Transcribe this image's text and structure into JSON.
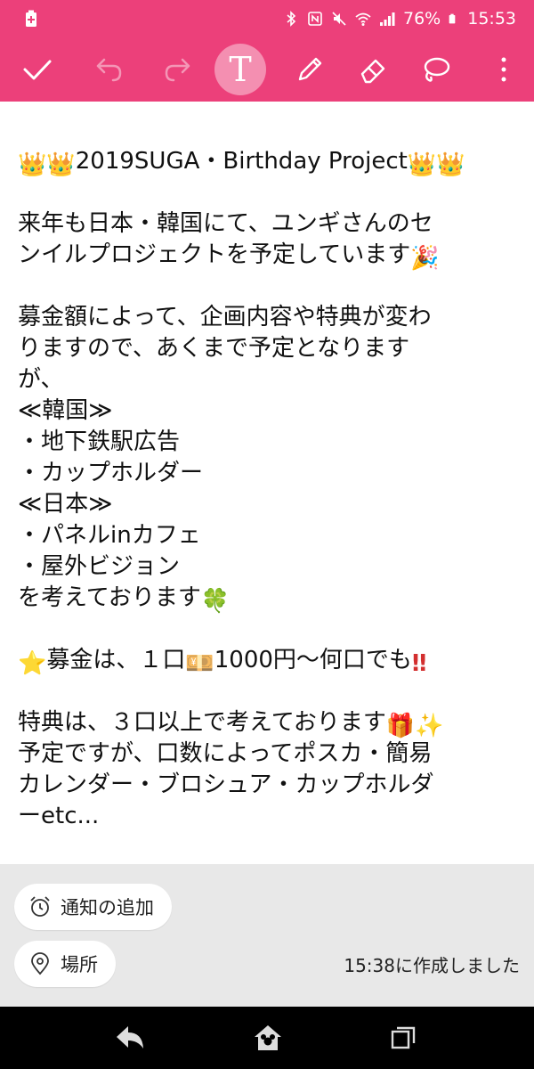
{
  "status_bar": {
    "battery_percent": "76%",
    "time": "15:53",
    "icons": [
      "battery-charging-icon",
      "bluetooth-icon",
      "nfc-icon",
      "mute-icon",
      "wifi-icon",
      "signal-icon",
      "battery-icon"
    ]
  },
  "toolbar": {
    "icons": [
      "checkmark-icon",
      "undo-icon",
      "redo-icon",
      "text-icon",
      "pen-icon",
      "eraser-icon",
      "lasso-icon",
      "more-icon"
    ],
    "text_tool_label": "T",
    "accent_color": "#ec407a"
  },
  "note": {
    "title_line": "2019SUGA・Birthday Project",
    "lines": [
      "来年も日本・韓国にて、ユンギさんのセ",
      "ンイルプロジェクトを予定しています",
      "募金額によって、企画内容や特典が変わ",
      "りますので、あくまで予定となります",
      "が、",
      "≪韓国≫",
      "・地下鉄駅広告",
      "・カップホルダー",
      "≪日本≫",
      "・パネルinカフェ",
      "・屋外ビジョン",
      "を考えております",
      "募金は、１口",
      "1000円～何口でも",
      "特典は、３口以上で考えております",
      "予定ですが、口数によってポスカ・簡易",
      "カレンダー・ブロシュア・カップホルダ",
      "ーetc..."
    ],
    "emoji": {
      "crown": "👑",
      "party": "🎉",
      "clover": "🍀",
      "star": "⭐",
      "yen": "💴",
      "exclaim": "‼",
      "gift": "🎁",
      "sparkles": "✨"
    }
  },
  "footer": {
    "reminder_label": "通知の追加",
    "location_label": "場所",
    "created_text": "15:38に作成しました"
  },
  "nav_bar": {
    "icons": [
      "back-icon",
      "home-icon",
      "recents-icon"
    ]
  }
}
